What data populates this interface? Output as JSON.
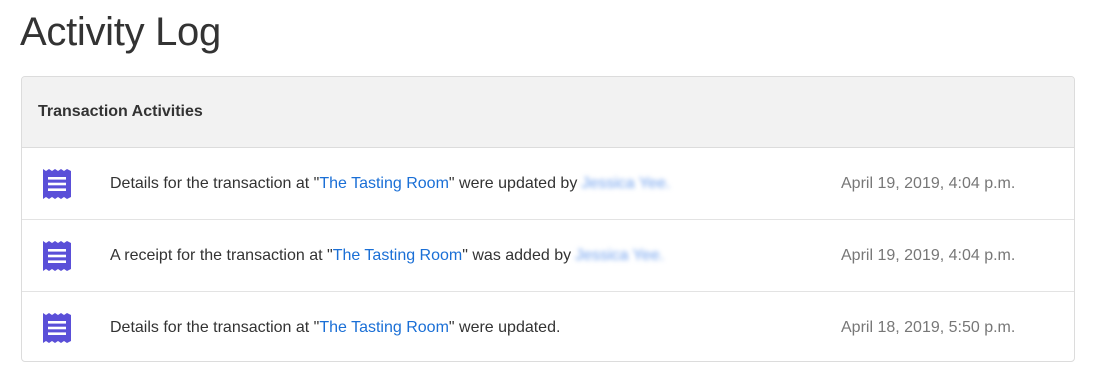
{
  "page": {
    "title": "Activity Log"
  },
  "panel": {
    "title": "Transaction Activities"
  },
  "colors": {
    "icon": "#5a4fd8",
    "link": "#1a6fd6",
    "date": "#777777",
    "header_bg": "#f2f2f2"
  },
  "activities": [
    {
      "icon": "receipt-icon",
      "prefix": "Details for the transaction at \"",
      "link": "The Tasting Room",
      "suffix": "\" were updated by",
      "user": "Jessica Yee.",
      "date": "April 19, 2019, 4:04 p.m."
    },
    {
      "icon": "receipt-icon",
      "prefix": "A receipt for the transaction at \"",
      "link": "The Tasting Room",
      "suffix": "\" was added by",
      "user": "Jessica Yee.",
      "date": "April 19, 2019, 4:04 p.m."
    },
    {
      "icon": "receipt-icon",
      "prefix": "Details for the transaction at \"",
      "link": "The Tasting Room",
      "suffix": "\" were updated.",
      "user": "",
      "date": "April 18, 2019, 5:50 p.m."
    }
  ]
}
